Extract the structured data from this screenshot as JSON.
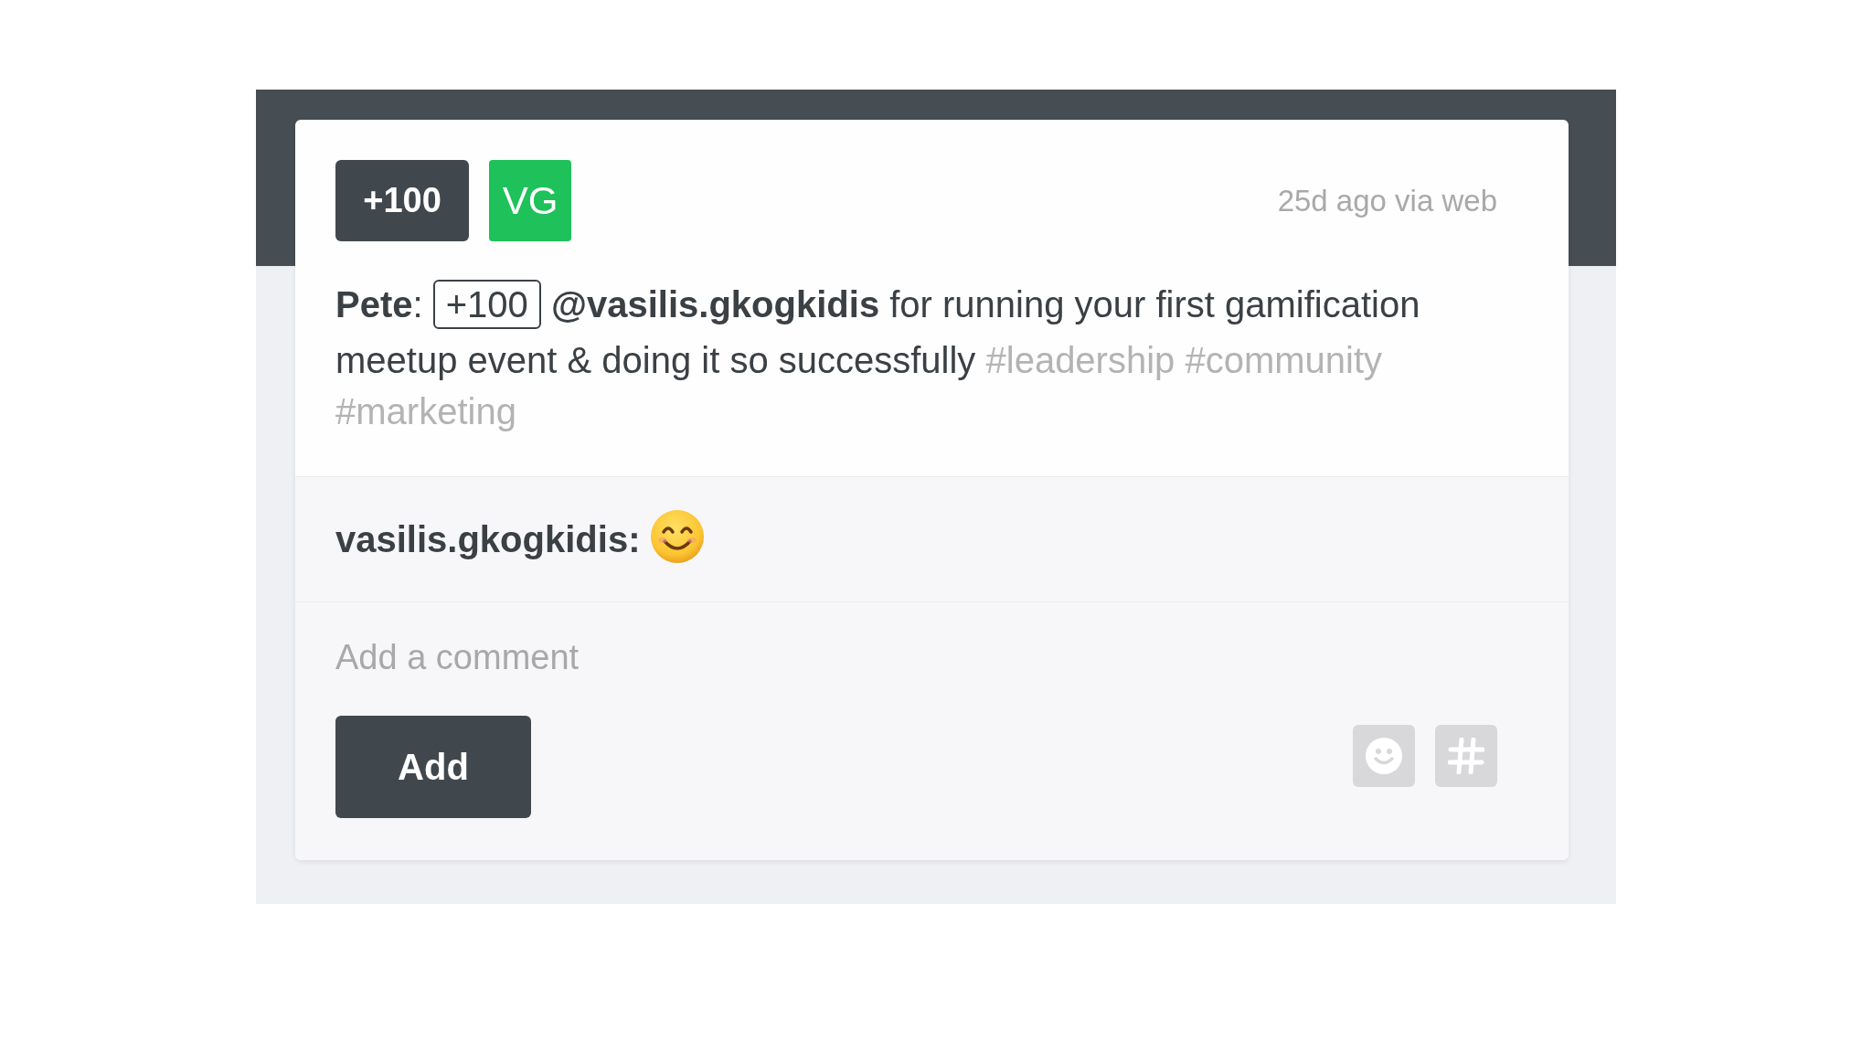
{
  "post": {
    "points_badge": "+100",
    "avatar_initials": "VG",
    "timestamp": "25d ago via web",
    "message": {
      "author_label": "**Pete**:",
      "points": "+100",
      "mention": "@vasilis.gkogkidis",
      "text": "for running your first gamification meetup event & doing it so successfully",
      "tags": [
        "#leadership",
        "#community",
        "#marketing"
      ]
    }
  },
  "comments": [
    {
      "author": "vasilis.gkogkidis:"
    }
  ],
  "comment_form": {
    "placeholder": "Add a comment",
    "submit": "Add"
  }
}
